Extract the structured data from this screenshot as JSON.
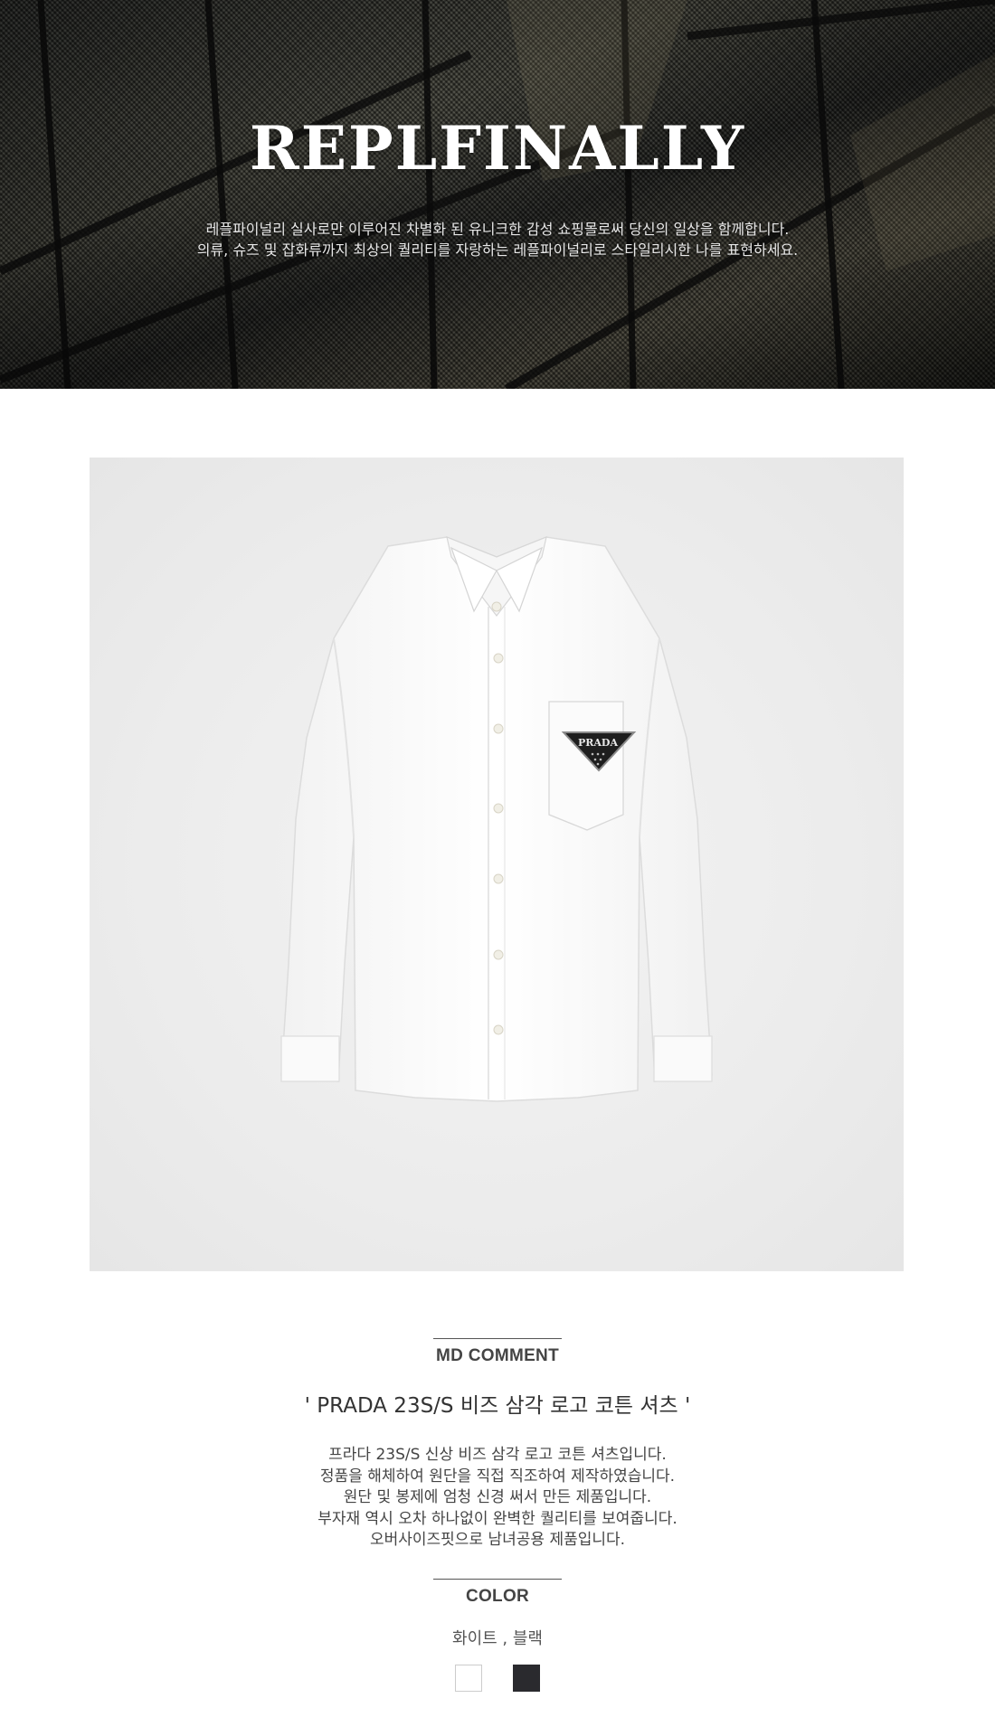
{
  "header": {
    "brand": "REPLFINALLY",
    "description_lines": [
      "레플파이널리 실사로만 이루어진 차별화 된 유니크한 감성 쇼핑몰로써 당신의 일상을 함께합니다.",
      "의류, 슈즈 및 잡화류까지 최상의 퀄리티를 자랑하는 레플파이널리로 스타일리시한 나를 표현하세요."
    ]
  },
  "product_image": {
    "logo_text": "PRADA"
  },
  "md_comment": {
    "label": "MD COMMENT",
    "title": "' PRADA 23S/S 비즈 삼각 로고 코튼 셔츠 '",
    "lines": [
      "프라다 23S/S 신상 비즈 삼각 로고 코튼 셔츠입니다.",
      "정품을 해체하여 원단을 직접 직조하여 제작하였습니다.",
      "원단 및 봉제에 엄청 신경 써서 만든 제품입니다.",
      "부자재 역시 오차 하나없이 완벽한 퀄리티를 보여줍니다.",
      "오버사이즈핏으로 남녀공용 제품입니다."
    ]
  },
  "color_section": {
    "label": "COLOR",
    "value": "화이트 , 블랙",
    "swatches": [
      {
        "name": "white",
        "color": "#ffffff",
        "border": "#cccccc"
      },
      {
        "name": "black",
        "color": "#2a2a2e",
        "border": "#2a2a2e"
      }
    ]
  }
}
